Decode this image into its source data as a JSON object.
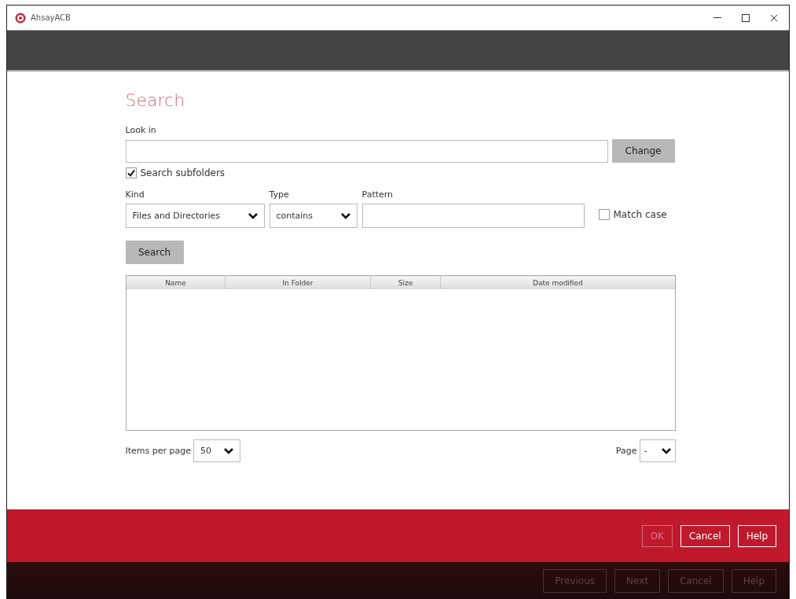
{
  "window": {
    "title": "AhsayACB"
  },
  "search_form": {
    "heading": "Search",
    "look_in": {
      "label": "Look in"
    },
    "change_button": "Change",
    "search_subfolders": {
      "label": "Search subfolders",
      "checked": true
    },
    "kind": {
      "label": "Kind",
      "value": "Files and Directories"
    },
    "type": {
      "label": "Type",
      "value": "contains"
    },
    "pattern": {
      "label": "Pattern"
    },
    "match_case": {
      "label": "Match case",
      "checked": false
    },
    "search_button": "Search"
  },
  "table": {
    "columns": [
      "Name",
      "In Folder",
      "Size",
      "Date modified"
    ]
  },
  "pagination": {
    "items_per_page_label": "Items per page",
    "items_per_page_value": "50",
    "page_label": "Page",
    "page_value": "-"
  },
  "dialog_buttons": [
    {
      "label": "OK",
      "disabled": true
    },
    {
      "label": "Cancel",
      "disabled": false
    },
    {
      "label": "Help",
      "disabled": false
    }
  ],
  "wizard_buttons": [
    {
      "label": "Previous",
      "disabled": true
    },
    {
      "label": "Next",
      "disabled": true
    },
    {
      "label": "Cancel",
      "disabled": true
    },
    {
      "label": "Help",
      "disabled": true
    }
  ]
}
